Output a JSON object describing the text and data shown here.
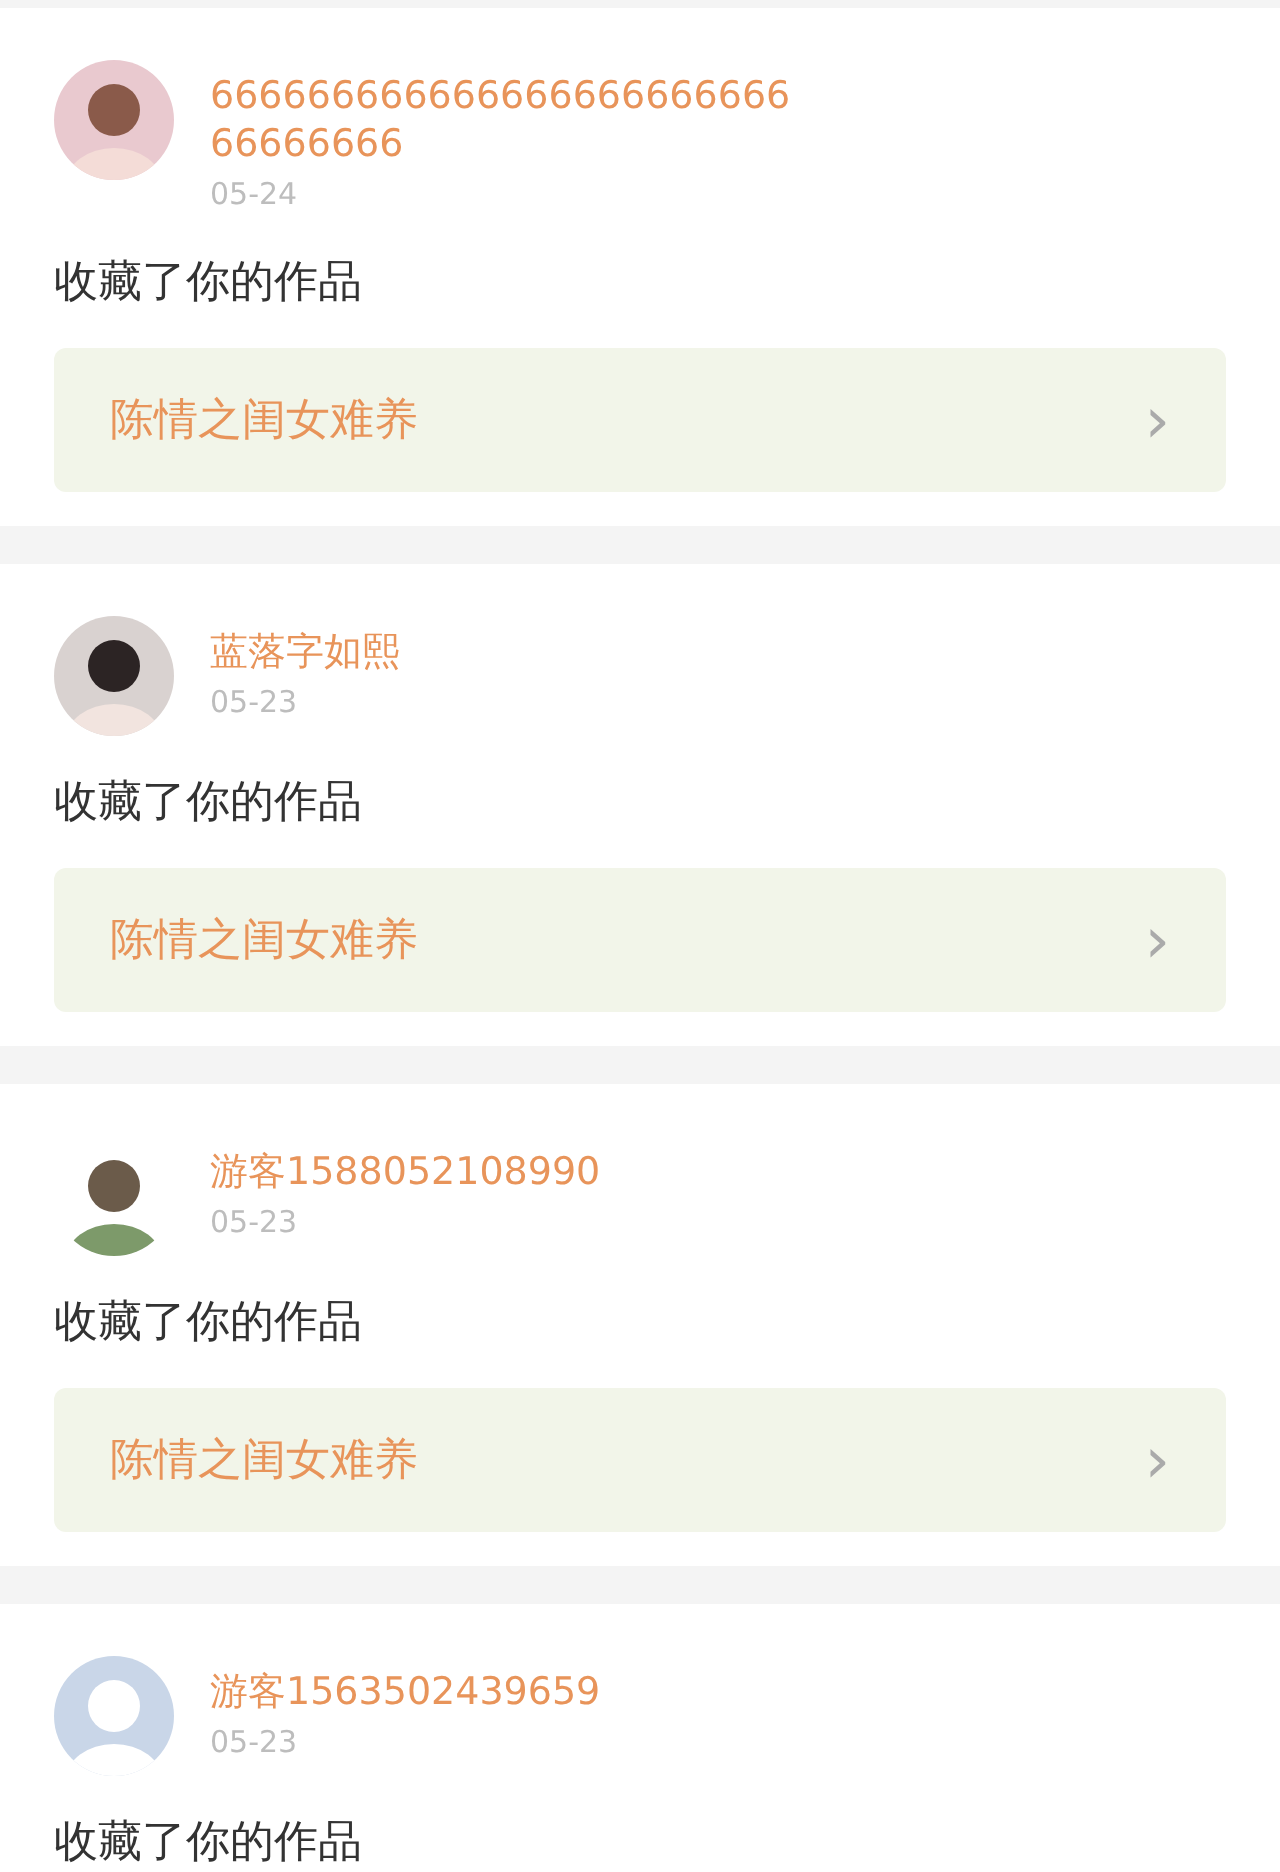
{
  "notifications": [
    {
      "user": "66666666666666666666666666666666",
      "date": "05-24",
      "action": "收藏了你的作品",
      "work": "陈情之闺女难养",
      "chevron": "›",
      "kind": "picture"
    },
    {
      "user": "蓝落字如熙",
      "date": "05-23",
      "action": "收藏了你的作品",
      "work": "陈情之闺女难养",
      "chevron": "›",
      "kind": "picture"
    },
    {
      "user": "游客1588052108990",
      "date": "05-23",
      "action": "收藏了你的作品",
      "work": "陈情之闺女难养",
      "chevron": "›",
      "kind": "picture"
    },
    {
      "user": "游客1563502439659",
      "date": "05-23",
      "action": "收藏了你的作品",
      "kind": "placeholder"
    }
  ]
}
